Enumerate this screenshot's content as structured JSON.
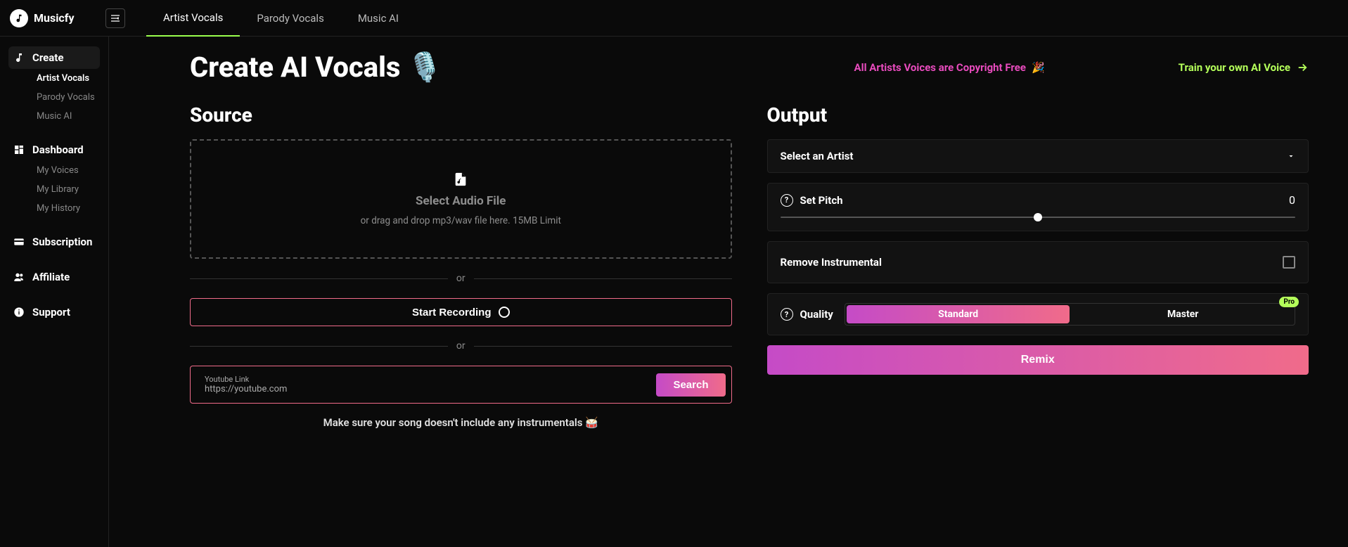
{
  "brand": "Musicfy",
  "tabs": [
    {
      "label": "Artist Vocals",
      "active": true
    },
    {
      "label": "Parody Vocals",
      "active": false
    },
    {
      "label": "Music AI",
      "active": false
    }
  ],
  "sidebar": {
    "sections": [
      {
        "title": "Create",
        "active": true,
        "items": [
          {
            "label": "Artist Vocals",
            "active": true
          },
          {
            "label": "Parody Vocals",
            "active": false
          },
          {
            "label": "Music AI",
            "active": false
          }
        ]
      },
      {
        "title": "Dashboard",
        "active": false,
        "items": [
          {
            "label": "My Voices",
            "active": false
          },
          {
            "label": "My Library",
            "active": false
          },
          {
            "label": "My History",
            "active": false
          }
        ]
      },
      {
        "title": "Subscription",
        "active": false,
        "items": []
      },
      {
        "title": "Affiliate",
        "active": false,
        "items": []
      },
      {
        "title": "Support",
        "active": false,
        "items": []
      }
    ]
  },
  "page": {
    "title": "Create AI Vocals",
    "title_emoji": "🎙️",
    "copyright_link": "All Artists Voices are Copyright Free",
    "copyright_emoji": "🎉",
    "train_link": "Train your own AI Voice"
  },
  "source": {
    "heading": "Source",
    "dropzone_title": "Select Audio File",
    "dropzone_sub": "or drag and drop mp3/wav file here. 15MB Limit",
    "or": "or",
    "record_label": "Start Recording",
    "youtube_label": "Youtube Link",
    "youtube_placeholder": "https://youtube.com",
    "search_label": "Search",
    "note": "Make sure your song doesn't include any instrumentals",
    "note_emoji": "🥁"
  },
  "output": {
    "heading": "Output",
    "select_artist": "Select an Artist",
    "pitch_label": "Set Pitch",
    "pitch_value": "0",
    "remove_instrumental": "Remove Instrumental",
    "quality_label": "Quality",
    "quality_options": {
      "standard": "Standard",
      "master": "Master"
    },
    "pro_badge": "Pro",
    "remix": "Remix"
  }
}
